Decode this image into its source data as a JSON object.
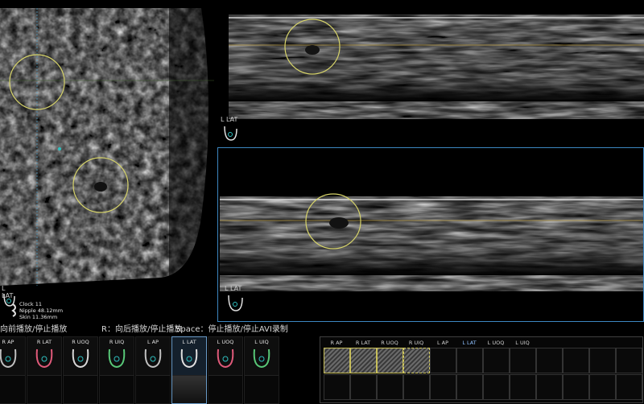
{
  "left_pane": {
    "orientation_label": "L LAT",
    "info": {
      "clock": "Clock 11",
      "nipple": "Nipple 48.12mm",
      "skin": "Skin 11.36mm"
    }
  },
  "top_pane": {
    "orientation_label": "L LAT"
  },
  "bottom_pane": {
    "orientation_label": "L LAT"
  },
  "hint_bar": {
    "forward": "向前播放/停止播放",
    "backward": "R：向后播放/停止播放",
    "space": "Space：停止播放/停止AVI录制"
  },
  "thumb_strip": {
    "items": [
      {
        "label": "R AP",
        "ring_color": "#c0c0c0"
      },
      {
        "label": "R LAT",
        "ring_color": "#e05a7a"
      },
      {
        "label": "R UOQ",
        "ring_color": "#d8d8d8"
      },
      {
        "label": "R UIQ",
        "ring_color": "#58c878"
      },
      {
        "label": "L AP",
        "ring_color": "#c0c0c0"
      },
      {
        "label": "L LAT",
        "ring_color": "#e0e0e0"
      },
      {
        "label": "L UOQ",
        "ring_color": "#e05a7a"
      },
      {
        "label": "L UIQ",
        "ring_color": "#58c878"
      }
    ],
    "active_index": 5
  },
  "grid_panel": {
    "headers": [
      "R AP",
      "R LAT",
      "R UOQ",
      "R UIQ",
      "L AP",
      "L LAT",
      "L UOQ",
      "L UIQ"
    ],
    "active_header": 5
  },
  "colors": {
    "cursor_ring": "#d6d36a",
    "crosshair": "#b89a40",
    "selection_border": "#3c86c0",
    "background": "#000000"
  }
}
